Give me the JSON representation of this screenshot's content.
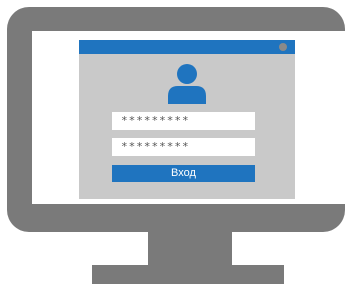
{
  "login_form": {
    "password_masked": "*********",
    "confirm_masked": "*********",
    "login_button_label": "Вход"
  },
  "icons": {
    "user": "user-icon",
    "window_control": "window-dot-icon"
  },
  "colors": {
    "accent": "#1f74bf",
    "monitor": "#7a7a7a",
    "window_bg": "#c9c9c9"
  }
}
